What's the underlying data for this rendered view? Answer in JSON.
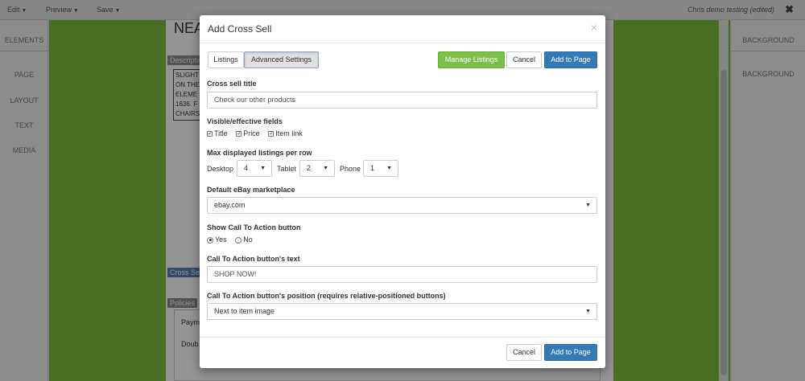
{
  "topbar": {
    "menus": [
      {
        "label": "Edit"
      },
      {
        "label": "Preview"
      },
      {
        "label": "Save"
      }
    ],
    "doc_title": "Chris demo testing (edited)",
    "close_glyph": "✖"
  },
  "left_panel": {
    "tabs": [
      "ELEMENTS",
      "PAGE",
      "LAYOUT",
      "TEXT",
      "MEDIA"
    ]
  },
  "right_panel": {
    "tabs": [
      "BACKGROUND",
      "BACKGROUND"
    ]
  },
  "page": {
    "heading": "NEAR",
    "description_label": "Description",
    "description_lines": [
      "SLIGHT",
      "ON THE",
      "ELEME",
      "1636. F",
      "CHAIRS"
    ],
    "cross_sell_label": "Cross Sell",
    "policies_label": "Policies",
    "policy_lines": [
      "Paym",
      "Doub"
    ]
  },
  "modal": {
    "title": "Add Cross Sell",
    "close_glyph": "×",
    "tabs": [
      {
        "label": "Listings"
      },
      {
        "label": "Advanced Settings"
      }
    ],
    "buttons": {
      "manage": "Manage Listings",
      "cancel": "Cancel",
      "add": "Add to Page"
    },
    "cross_sell_title": {
      "label": "Cross sell title",
      "value": "Check our other products"
    },
    "visible_fields": {
      "label": "Visible/effective fields",
      "items": [
        {
          "label": "Title",
          "checked": true
        },
        {
          "label": "Price",
          "checked": true
        },
        {
          "label": "Item link",
          "checked": true
        }
      ]
    },
    "max_listings": {
      "label": "Max displayed listings per row",
      "desktop": {
        "label": "Desktop",
        "value": "4"
      },
      "tablet": {
        "label": "Tablet",
        "value": "2"
      },
      "phone": {
        "label": "Phone",
        "value": "1"
      }
    },
    "marketplace": {
      "label": "Default eBay marketplace",
      "value": "ebay.com"
    },
    "cta_show": {
      "label": "Show Call To Action button",
      "yes": "Yes",
      "no": "No",
      "selected": "Yes"
    },
    "cta_text": {
      "label": "Call To Action button's text",
      "value": "SHOP NOW!"
    },
    "cta_position": {
      "label": "Call To Action button's position (requires relative-positioned buttons)",
      "value": "Next to item image"
    },
    "footer": {
      "cancel": "Cancel",
      "add": "Add to Page"
    }
  },
  "colors": {
    "canvas_green": "#7bbf3b",
    "primary_blue": "#337ab7",
    "manage_green": "#7cc04a"
  },
  "icons": {
    "dropdown": "caret-down-icon",
    "checkbox": "checkmark-icon"
  }
}
